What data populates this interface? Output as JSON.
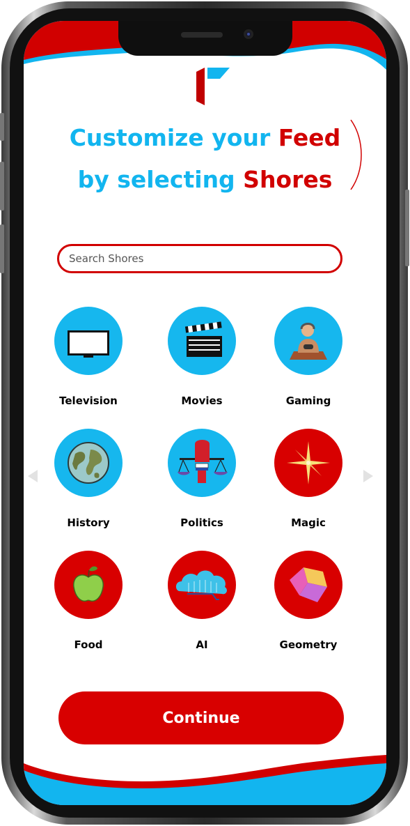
{
  "headline": {
    "line1_blue": "Customize your ",
    "line1_red": "Feed",
    "line2_blue": "by selecting ",
    "line2_red": "Shores"
  },
  "search": {
    "placeholder": "Search Shores",
    "value": ""
  },
  "categories": [
    {
      "label": "Television",
      "icon": "television-icon",
      "bg": "#16b7ee"
    },
    {
      "label": "Movies",
      "icon": "clapperboard-icon",
      "bg": "#16b7ee"
    },
    {
      "label": "Gaming",
      "icon": "gamer-icon",
      "bg": "#16b7ee"
    },
    {
      "label": "History",
      "icon": "globe-icon",
      "bg": "#16b7ee"
    },
    {
      "label": "Politics",
      "icon": "scales-fist-icon",
      "bg": "#16b7ee"
    },
    {
      "label": "Magic",
      "icon": "sparkle-icon",
      "bg": "#d80000"
    },
    {
      "label": "Food",
      "icon": "apple-icon",
      "bg": "#d80000"
    },
    {
      "label": "AI",
      "icon": "cloud-circuit-icon",
      "bg": "#d80000"
    },
    {
      "label": "Geometry",
      "icon": "cube-icon",
      "bg": "#d80000"
    }
  ],
  "continue_label": "Continue",
  "colors": {
    "brand_red": "#d80000",
    "brand_blue": "#16b7ee"
  }
}
